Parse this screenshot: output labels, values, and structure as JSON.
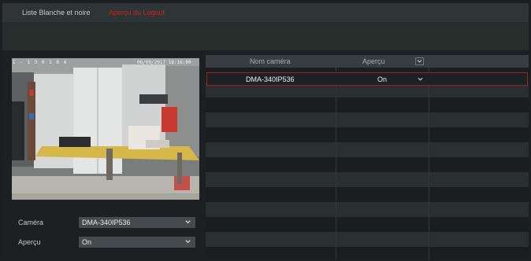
{
  "tabs": [
    {
      "label": "Liste Blanche et noire",
      "active": false
    },
    {
      "label": "Aperçu du Logout",
      "active": true
    }
  ],
  "preview": {
    "osd_left": "I  -  1 3 0 1  8 4",
    "osd_right": "06/09/2017 18:16:00"
  },
  "form": {
    "camera_label": "Caméra",
    "camera_value": "DMA-340IP536",
    "preview_label": "Aperçu",
    "preview_value": "On"
  },
  "table": {
    "columns": [
      "Nom caméra",
      "Aperçu"
    ],
    "rows": [
      {
        "camera": "DMA-340IP536",
        "preview": "On",
        "selected": true
      }
    ]
  },
  "colors": {
    "accent_red": "#d21f1f",
    "selection_border": "#9b1f1f",
    "background": "#1c2023"
  }
}
